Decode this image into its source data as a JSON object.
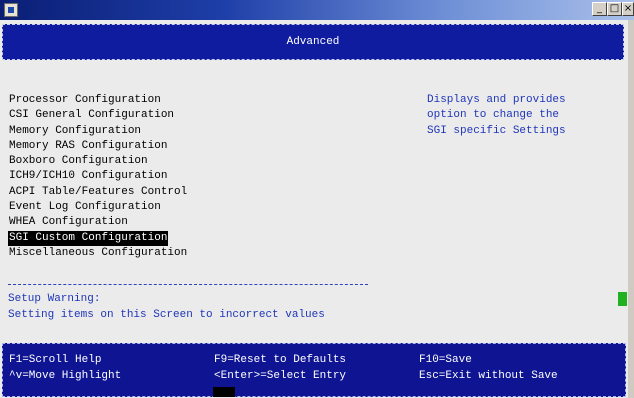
{
  "window": {
    "title": "",
    "minimize_glyph": "_",
    "maximize_glyph": "□",
    "close_glyph": "×"
  },
  "header": {
    "title": "Advanced"
  },
  "menu": {
    "items": [
      "Processor Configuration",
      "CSI General Configuration",
      "Memory Configuration",
      "Memory RAS Configuration",
      "Boxboro Configuration",
      "ICH9/ICH10 Configuration",
      "ACPI Table/Features Control",
      "Event Log Configuration",
      "WHEA Configuration",
      "SGI Custom Configuration",
      "Miscellaneous Configuration"
    ],
    "selected_index": 9
  },
  "help": {
    "lines": [
      "Displays and provides",
      "option to change the",
      "SGI specific Settings"
    ]
  },
  "warning": {
    "title": "Setup Warning:",
    "text": "Setting items on this Screen to incorrect values"
  },
  "footer": {
    "f1": "F1=Scroll Help",
    "move": "^v=Move Highlight",
    "f9": "F9=Reset to Defaults",
    "enter": "<Enter>=Select Entry",
    "f10": "F10=Save",
    "esc": "Esc=Exit without Save"
  },
  "colors": {
    "header_bg": "#101ca0",
    "footer_bg": "#0e1492",
    "help_text": "#1f36b8",
    "selected_bg": "#000000",
    "marker": "#20b020"
  }
}
